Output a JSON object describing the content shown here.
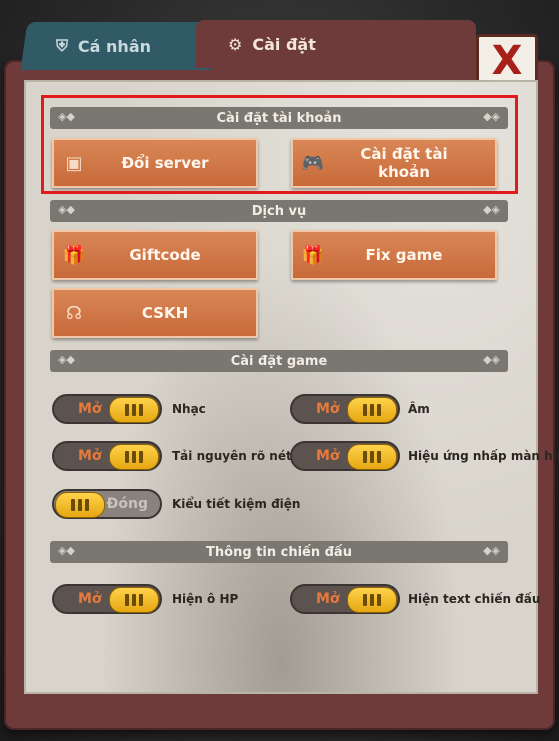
{
  "tabs": {
    "personal": "Cá nhân",
    "settings": "Cài đặt"
  },
  "close_symbol": "X",
  "sections": {
    "account": "Cài đặt tài khoản",
    "services": "Dịch vụ",
    "game": "Cài đặt game",
    "battle": "Thông tin chiến đấu"
  },
  "buttons": {
    "change_server": "Đổi server",
    "account_settings": "Cài đặt tài khoản",
    "giftcode": "Giftcode",
    "fix_game": "Fix game",
    "cskh": "CSKH"
  },
  "toggles": {
    "on_text": "Mở",
    "off_text": "Đóng",
    "music": {
      "label": "Nhạc",
      "state": "on"
    },
    "sound": {
      "label": "Âm",
      "state": "on"
    },
    "hd_resources": {
      "label": "Tải nguyên rõ nét",
      "state": "on"
    },
    "tap_effect": {
      "label": "Hiệu ứng nhấp màn hình",
      "state": "on"
    },
    "power_saving": {
      "label": "Kiểu tiết kiệm điện",
      "state": "off"
    },
    "show_hp": {
      "label": "Hiện ô HP",
      "state": "on"
    },
    "show_battle_text": {
      "label": "Hiện text chiến đấu",
      "state": "on"
    }
  }
}
